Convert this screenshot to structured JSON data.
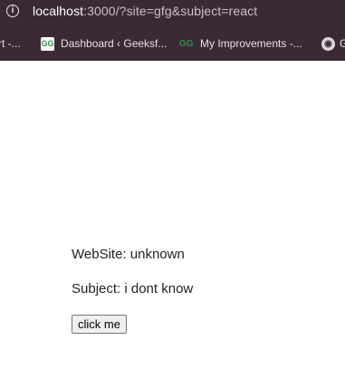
{
  "browser": {
    "url_host": "localhost",
    "url_rest": ":3000/?site=gfg&subject=react",
    "bookmarks": [
      {
        "label": "rt -...",
        "icon": "none"
      },
      {
        "label": "Dashboard ‹ Geeksf...",
        "icon": "geeksforgeeks-icon"
      },
      {
        "label": "My Improvements -...",
        "icon": "geeksforgeeks-icon"
      },
      {
        "label": "G",
        "icon": "github-icon"
      }
    ]
  },
  "page": {
    "site_line": "WebSite: unknown",
    "subject_line": "Subject: i dont know",
    "button_label": "click me"
  }
}
